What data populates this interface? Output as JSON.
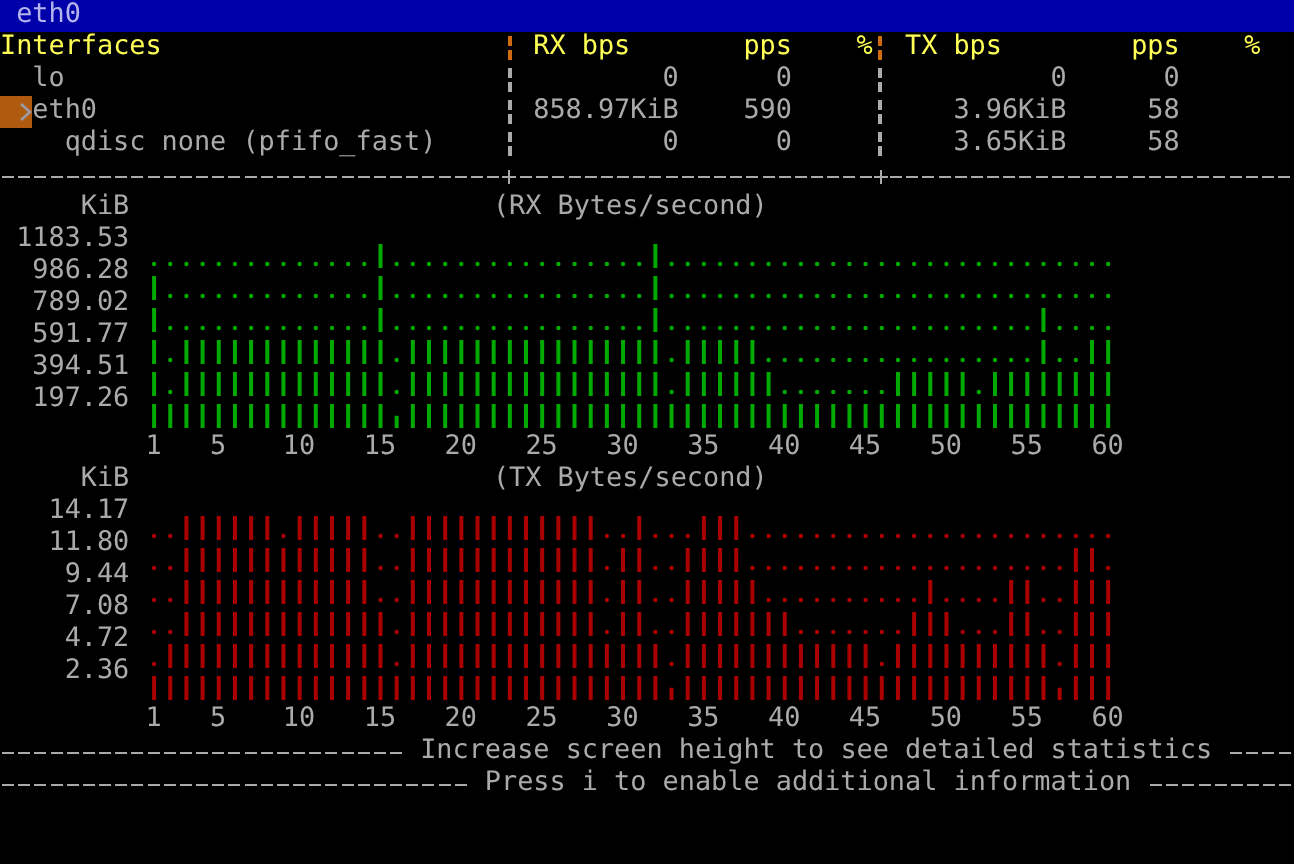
{
  "window": {
    "title": "eth0"
  },
  "interfaces": {
    "columns": {
      "name": "Interfaces",
      "rx_bps": "RX bps",
      "rx_pps": "pps",
      "rx_pct": "%",
      "tx_bps": "TX bps",
      "tx_pps": "pps",
      "tx_pct": "%"
    },
    "rows": [
      {
        "name": "lo",
        "selected": false,
        "rx_bps": "0",
        "rx_pps": "0",
        "tx_bps": "0",
        "tx_pps": "0"
      },
      {
        "name": "eth0",
        "selected": true,
        "rx_bps": "858.97KiB",
        "rx_pps": "590",
        "tx_bps": "3.96KiB",
        "tx_pps": "58",
        "children": [
          {
            "name": "qdisc none (pfifo_fast)",
            "selected": false,
            "rx_bps": "0",
            "rx_pps": "0",
            "tx_bps": "3.65KiB",
            "tx_pps": "58"
          }
        ]
      }
    ]
  },
  "graphs": [
    {
      "chart_data": {
        "type": "bar",
        "title": "(RX Bytes/second)",
        "ylabel": "KiB",
        "x": [
          1,
          2,
          3,
          4,
          5,
          6,
          7,
          8,
          9,
          10,
          11,
          12,
          13,
          14,
          15,
          16,
          17,
          18,
          19,
          20,
          21,
          22,
          23,
          24,
          25,
          26,
          27,
          28,
          29,
          30,
          31,
          32,
          33,
          34,
          35,
          36,
          37,
          38,
          39,
          40,
          41,
          42,
          43,
          44,
          45,
          46,
          47,
          48,
          49,
          50,
          51,
          52,
          53,
          54,
          55,
          56,
          57,
          58,
          59,
          60
        ],
        "xlim": [
          1,
          60
        ],
        "xticks": [
          1,
          5,
          10,
          15,
          20,
          25,
          30,
          35,
          40,
          45,
          50,
          55,
          60
        ],
        "yticks": [
          197.26,
          394.51,
          591.77,
          789.02,
          986.28,
          1183.53
        ],
        "ylim": [
          0,
          1183.53
        ],
        "series": [
          {
            "color": "#00aa00",
            "values": [
              990,
              200,
              590,
              590,
              590,
              590,
              590,
              590,
              590,
              590,
              590,
              590,
              590,
              590,
              1180,
              100,
              590,
              590,
              590,
              590,
              590,
              590,
              590,
              590,
              590,
              590,
              590,
              590,
              590,
              590,
              590,
              1180,
              200,
              590,
              590,
              590,
              590,
              590,
              390,
              200,
              200,
              200,
              200,
              200,
              200,
              200,
              390,
              390,
              390,
              390,
              390,
              200,
              390,
              390,
              390,
              790,
              390,
              390,
              590,
              590
            ]
          }
        ]
      }
    },
    {
      "chart_data": {
        "type": "bar",
        "title": "(TX Bytes/second)",
        "ylabel": "KiB",
        "x": [
          1,
          2,
          3,
          4,
          5,
          6,
          7,
          8,
          9,
          10,
          11,
          12,
          13,
          14,
          15,
          16,
          17,
          18,
          19,
          20,
          21,
          22,
          23,
          24,
          25,
          26,
          27,
          28,
          29,
          30,
          31,
          32,
          33,
          34,
          35,
          36,
          37,
          38,
          39,
          40,
          41,
          42,
          43,
          44,
          45,
          46,
          47,
          48,
          49,
          50,
          51,
          52,
          53,
          54,
          55,
          56,
          57,
          58,
          59,
          60
        ],
        "xlim": [
          1,
          60
        ],
        "xticks": [
          1,
          5,
          10,
          15,
          20,
          25,
          30,
          35,
          40,
          45,
          50,
          55,
          60
        ],
        "yticks": [
          2.36,
          4.72,
          7.08,
          9.44,
          {
            "value": 11.8,
            "label": "11.80"
          },
          14.17
        ],
        "ylim": [
          0,
          14.17
        ],
        "series": [
          {
            "color": "#aa0000",
            "values": [
              2.4,
              4.7,
              14.1,
              14.1,
              14.1,
              14.1,
              14.1,
              14.1,
              11.8,
              14.1,
              14.1,
              14.1,
              14.1,
              14.1,
              7.1,
              2.4,
              14.1,
              14.1,
              14.1,
              14.1,
              14.1,
              14.1,
              14.1,
              14.1,
              14.1,
              14.1,
              14.1,
              14.1,
              4.7,
              11.8,
              14.1,
              4.7,
              1.2,
              11.8,
              14.1,
              14.1,
              14.1,
              9.4,
              7.1,
              7.1,
              4.7,
              4.7,
              4.7,
              4.7,
              4.7,
              2.4,
              4.7,
              7.1,
              9.4,
              7.1,
              4.7,
              4.7,
              4.7,
              9.4,
              9.4,
              4.7,
              1.2,
              11.8,
              11.8,
              9.4
            ]
          }
        ]
      }
    }
  ],
  "footer": [
    "Increase screen height to see detailed statistics",
    "Press i to enable additional information"
  ]
}
